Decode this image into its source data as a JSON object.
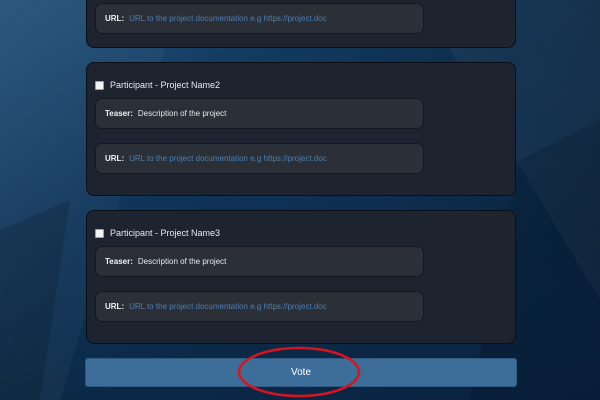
{
  "cards": [
    {
      "url_label": "URL:",
      "url_placeholder": "URL to the project documentation e.g https://project.doc"
    },
    {
      "participant": "Participant - Project Name2",
      "teaser_label": "Teaser:",
      "teaser_text": "Description of the project",
      "url_label": "URL:",
      "url_placeholder": "URL to the project documentation e.g https://project.doc"
    },
    {
      "participant": "Participant - Project Name3",
      "teaser_label": "Teaser:",
      "teaser_text": "Description of the project",
      "url_label": "URL:",
      "url_placeholder": "URL to the project documentation e.g https://project.doc"
    }
  ],
  "vote_button": {
    "label": "Vote"
  },
  "annotation": {
    "shape": "red-ellipse",
    "color": "#d8141f"
  },
  "colors": {
    "card_bg": "#1d2430",
    "field_bg": "#2b3038",
    "url_text": "#4c7fb0",
    "button_bg": "#3d6d99"
  }
}
